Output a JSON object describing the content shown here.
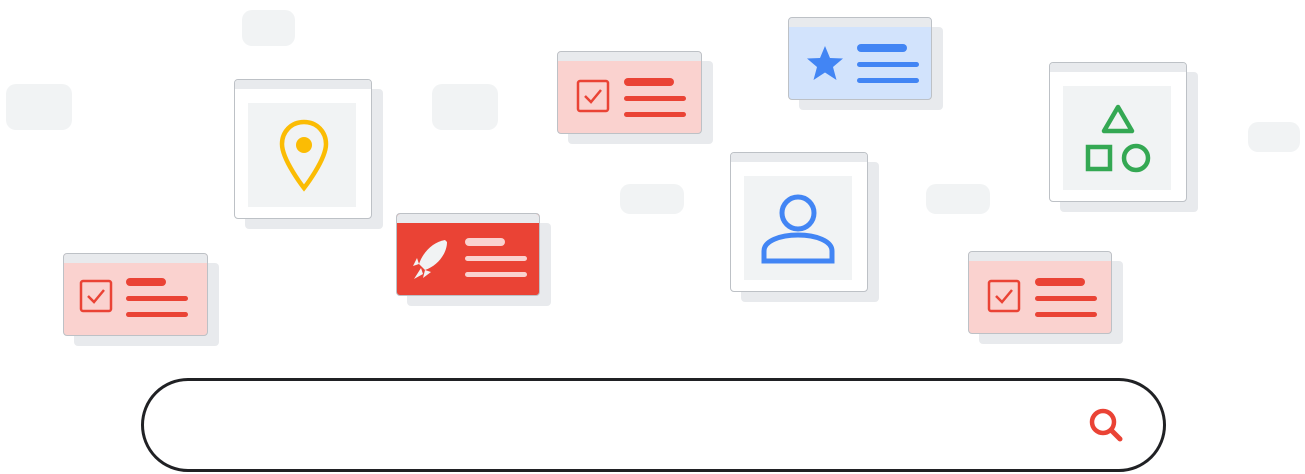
{
  "colors": {
    "placeholder_pill": "#f1f3f4",
    "card_border": "#bdc1c6",
    "card_shadow": "#e8eaed",
    "card_tint_red": "#fad2cf",
    "card_tint_blue": "#d2e3fc",
    "card_white": "#ffffff",
    "card_inner_gray": "#f1f3f4",
    "topbar_gray": "#e8eaed",
    "red": "#ea4335",
    "blue": "#4285f4",
    "yellow": "#fbbc04",
    "green": "#34a853",
    "search_border": "#202124"
  },
  "cards": [
    {
      "name": "task-card",
      "icon": "checkbox-icon",
      "tint": "red"
    },
    {
      "name": "location-card",
      "icon": "location-pin-icon",
      "tint": "white"
    },
    {
      "name": "launch-card",
      "icon": "rocket-icon",
      "tint": "solid-red"
    },
    {
      "name": "task-card",
      "icon": "checkbox-icon",
      "tint": "red"
    },
    {
      "name": "favorite-card",
      "icon": "star-icon",
      "tint": "blue"
    },
    {
      "name": "profile-card",
      "icon": "person-icon",
      "tint": "white"
    },
    {
      "name": "shapes-card",
      "icon": "shapes-icon",
      "tint": "white"
    },
    {
      "name": "task-card",
      "icon": "checkbox-icon",
      "tint": "red"
    }
  ],
  "search": {
    "placeholder": "",
    "value": "",
    "icon": "search-icon"
  }
}
